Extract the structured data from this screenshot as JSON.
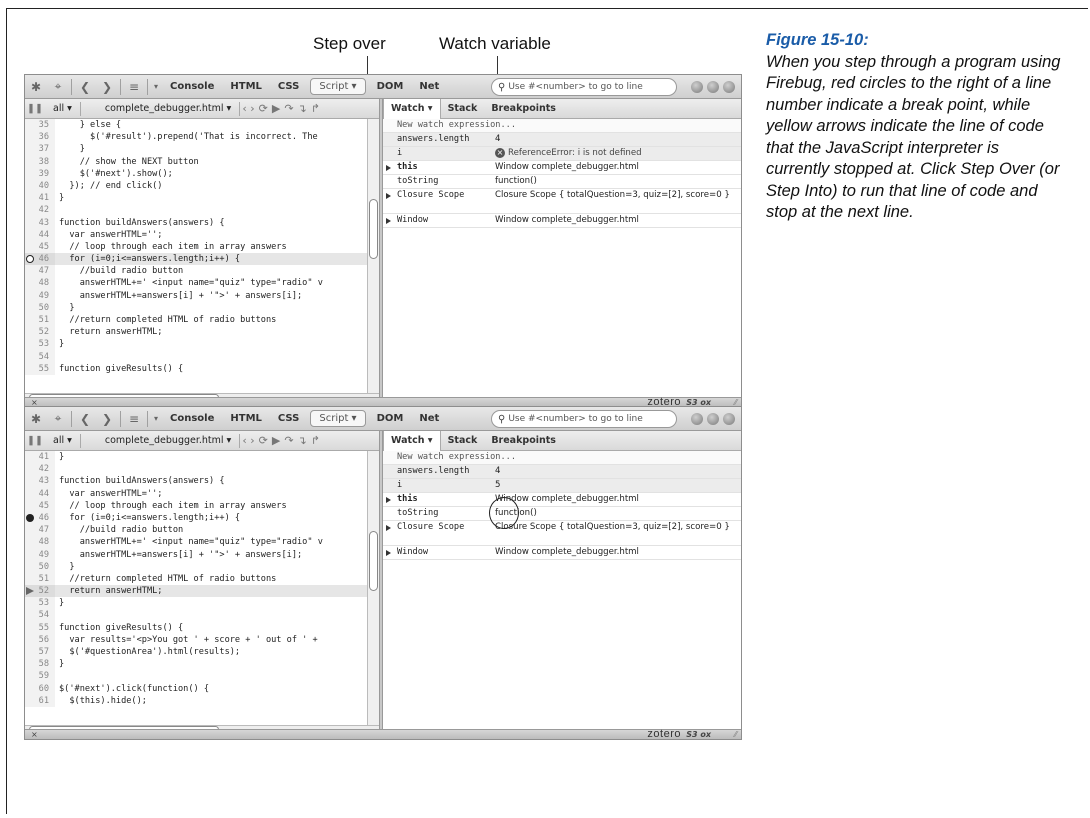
{
  "figure": {
    "title": "Figure 15-10:",
    "text": "When you step through a program using Firebug, red circles to the right of a line number indicate a break point, while yellow arrows indicate the line of code that the JavaScript interpreter is currently stopped at. Click Step Over (or Step Into) to run that line of code and stop at the next line."
  },
  "callouts": {
    "step_over": "Step over",
    "watch_variable": "Watch variable"
  },
  "toolbar": {
    "tabs": [
      "Console",
      "HTML",
      "CSS",
      "Script ▾",
      "DOM",
      "Net"
    ],
    "search_placeholder": "Use #<number> to go to line"
  },
  "subbar": {
    "all": "all ▾",
    "file": "complete_debugger.html ▾"
  },
  "watch_tabs": [
    "Watch ▾",
    "Stack",
    "Breakpoints"
  ],
  "watch_new": "New watch expression...",
  "status": {
    "close": "×",
    "zotero": "zotero",
    "s3": "S3 ox"
  },
  "panel1": {
    "code": [
      {
        "n": "35",
        "t": "    } else {"
      },
      {
        "n": "36",
        "t": "      $('#result').prepend('That is incorrect. The"
      },
      {
        "n": "37",
        "t": "    }"
      },
      {
        "n": "38",
        "t": "    // show the NEXT button"
      },
      {
        "n": "39",
        "t": "    $('#next').show();"
      },
      {
        "n": "40",
        "t": "  }); // end click()"
      },
      {
        "n": "41",
        "t": "}"
      },
      {
        "n": "42",
        "t": ""
      },
      {
        "n": "43",
        "t": "function buildAnswers(answers) {"
      },
      {
        "n": "44",
        "t": "  var answerHTML='';"
      },
      {
        "n": "45",
        "t": "  // loop through each item in array answers"
      },
      {
        "n": "46",
        "t": "  for (i=0;i<=answers.length;i++) {"
      },
      {
        "n": "47",
        "t": "    //build radio button"
      },
      {
        "n": "48",
        "t": "    answerHTML+=' <input name=\"quiz\" type=\"radio\" v"
      },
      {
        "n": "49",
        "t": "    answerHTML+=answers[i] + '\">' + answers[i];"
      },
      {
        "n": "50",
        "t": "  }"
      },
      {
        "n": "51",
        "t": "  //return completed HTML of radio buttons"
      },
      {
        "n": "52",
        "t": "  return answerHTML;"
      },
      {
        "n": "53",
        "t": "}"
      },
      {
        "n": "54",
        "t": ""
      },
      {
        "n": "55",
        "t": "function giveResults() {"
      }
    ],
    "watch": [
      {
        "name": "answers.length",
        "value": "4",
        "shaded": true
      },
      {
        "name": "i",
        "value": "ReferenceError: i is not defined",
        "error": true,
        "shaded": true
      },
      {
        "name": "this",
        "value": "Window complete_debugger.html",
        "bold": true,
        "tri": true
      },
      {
        "name": "toString",
        "value": "function()"
      },
      {
        "name": "Closure Scope",
        "value": "Closure Scope { totalQuestion=3, quiz=[2], score=0 }",
        "tri": true,
        "tall": true
      },
      {
        "name": "Window",
        "value": "Window complete_debugger.html",
        "tri": true
      }
    ]
  },
  "panel2": {
    "code": [
      {
        "n": "41",
        "t": "}"
      },
      {
        "n": "42",
        "t": ""
      },
      {
        "n": "43",
        "t": "function buildAnswers(answers) {"
      },
      {
        "n": "44",
        "t": "  var answerHTML='';"
      },
      {
        "n": "45",
        "t": "  // loop through each item in array answers"
      },
      {
        "n": "46",
        "t": "  for (i=0;i<=answers.length;i++) {"
      },
      {
        "n": "47",
        "t": "    //build radio button"
      },
      {
        "n": "48",
        "t": "    answerHTML+=' <input name=\"quiz\" type=\"radio\" v"
      },
      {
        "n": "49",
        "t": "    answerHTML+=answers[i] + '\">' + answers[i];"
      },
      {
        "n": "50",
        "t": "  }"
      },
      {
        "n": "51",
        "t": "  //return completed HTML of radio buttons"
      },
      {
        "n": "52",
        "t": "  return answerHTML;"
      },
      {
        "n": "53",
        "t": "}"
      },
      {
        "n": "54",
        "t": ""
      },
      {
        "n": "55",
        "t": "function giveResults() {"
      },
      {
        "n": "56",
        "t": "  var results='<p>You got ' + score + ' out of ' +"
      },
      {
        "n": "57",
        "t": "  $('#questionArea').html(results);"
      },
      {
        "n": "58",
        "t": "}"
      },
      {
        "n": "59",
        "t": ""
      },
      {
        "n": "60",
        "t": "$('#next').click(function() {"
      },
      {
        "n": "61",
        "t": "  $(this).hide();"
      }
    ],
    "watch": [
      {
        "name": "answers.length",
        "value": "4",
        "shaded": true
      },
      {
        "name": "i",
        "value": "5",
        "shaded": true
      },
      {
        "name": "this",
        "value": "Window complete_debugger.html",
        "bold": true,
        "tri": true
      },
      {
        "name": "toString",
        "value": "function()"
      },
      {
        "name": "Closure Scope",
        "value": "Closure Scope { totalQuestion=3, quiz=[2], score=0 }",
        "tri": true,
        "tall": true
      },
      {
        "name": "Window",
        "value": "Window complete_debugger.html",
        "tri": true
      }
    ]
  }
}
